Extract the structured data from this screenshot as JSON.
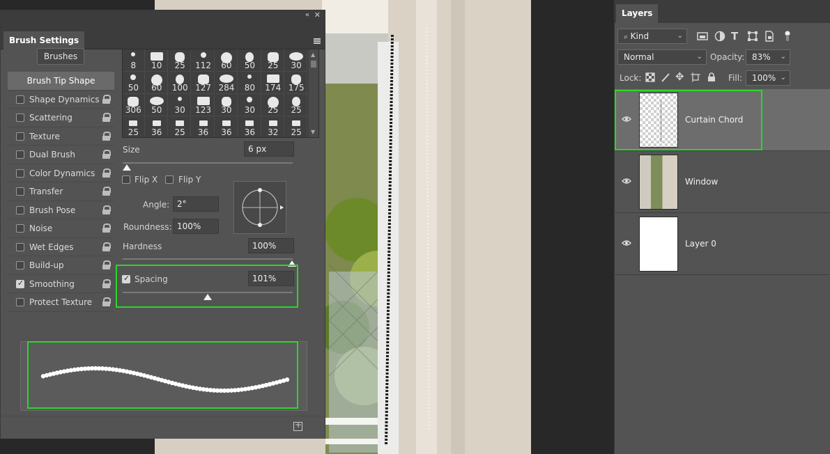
{
  "colors": {
    "panel_bg": "#535353",
    "highlight_box": "#2bd62b",
    "canvas_bg": "#282828"
  },
  "brush_settings": {
    "title": "Brush Settings",
    "brushes_button": "Brushes",
    "options": [
      {
        "label": "Brush Tip Shape",
        "selected": true
      },
      {
        "label": "Shape Dynamics",
        "checked": false
      },
      {
        "label": "Scattering",
        "checked": false
      },
      {
        "label": "Texture",
        "checked": false
      },
      {
        "label": "Dual Brush",
        "checked": false
      },
      {
        "label": "Color Dynamics",
        "checked": false
      },
      {
        "label": "Transfer",
        "checked": false
      },
      {
        "label": "Brush Pose",
        "checked": false
      },
      {
        "label": "Noise",
        "checked": false
      },
      {
        "label": "Wet Edges",
        "checked": false
      },
      {
        "label": "Build-up",
        "checked": false
      },
      {
        "label": "Smoothing",
        "checked": true
      },
      {
        "label": "Protect Texture",
        "checked": false
      }
    ],
    "tips": [
      "8",
      "10",
      "25",
      "112",
      "60",
      "50",
      "25",
      "30",
      "50",
      "60",
      "100",
      "127",
      "284",
      "80",
      "174",
      "175",
      "306",
      "50",
      "30",
      "123",
      "30",
      "30",
      "25",
      "25",
      "25",
      "36",
      "25",
      "36",
      "36",
      "36",
      "32",
      "25"
    ],
    "size_label": "Size",
    "size_value": "6 px",
    "flip_x": "Flip X",
    "flip_y": "Flip Y",
    "angle_label": "Angle:",
    "angle_value": "2°",
    "roundness_label": "Roundness:",
    "roundness_value": "100%",
    "hardness_label": "Hardness",
    "hardness_value": "100%",
    "spacing_label": "Spacing",
    "spacing_value": "101%",
    "spacing_checked": true
  },
  "layers": {
    "title": "Layers",
    "kind_filter": "Kind",
    "blend_mode": "Normal",
    "opacity_label": "Opacity:",
    "opacity_value": "83%",
    "lock_label": "Lock:",
    "fill_label": "Fill:",
    "fill_value": "100%",
    "items": [
      {
        "name": "Curtain Chord",
        "selected": true
      },
      {
        "name": "Window",
        "selected": false
      },
      {
        "name": "Layer 0",
        "selected": false
      }
    ]
  }
}
